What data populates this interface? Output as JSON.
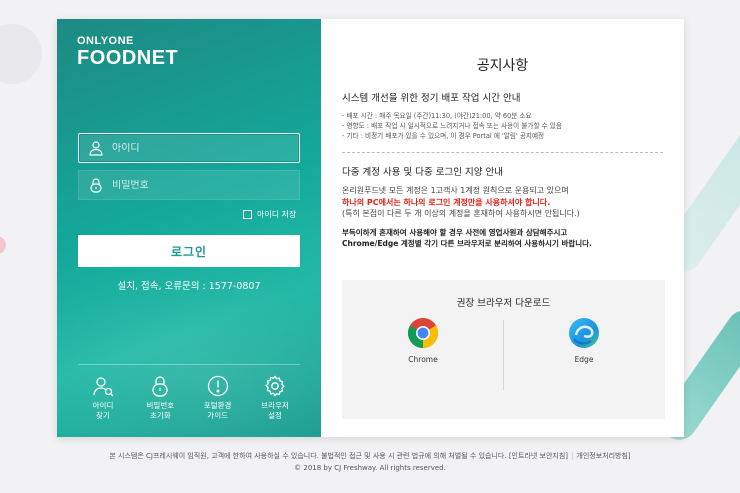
{
  "brand": {
    "line1": "ONLYONE",
    "line2": "FOODNET"
  },
  "login": {
    "id_placeholder": "아이디",
    "pw_placeholder": "비밀번호",
    "save_id_label": "아이디 저장",
    "login_button": "로그인",
    "contact": "설치, 접속, 오류문의 : 1577-0807"
  },
  "quick_links": [
    {
      "icon": "person-icon",
      "line1": "아이디",
      "line2": "찾기"
    },
    {
      "icon": "lock-icon",
      "line1": "비밀번호",
      "line2": "초기화"
    },
    {
      "icon": "alert-icon",
      "line1": "포털환경",
      "line2": "가이드"
    },
    {
      "icon": "gear-icon",
      "line1": "브라우저",
      "line2": "설정"
    }
  ],
  "notice": {
    "title": "공지사항",
    "section1": {
      "title": "시스템 개선을 위한 정기 배포 작업 시간 안내",
      "lines": [
        "- 배포 시간 : 매주 목요일 (주간)11:30, (야간)21:00, 약 60분 소요",
        "- 영향도 : 배포 작업 시 일시적으로 느려지거나 접속 또는 사용이 불가할 수 있음",
        "- 기타 : 비정기 배포가 있을 수 있으며, 이 경우 Portal 에 '알림' 공지예정"
      ]
    },
    "section2": {
      "title": "다중 계정 사용 및 다중 로그인 지양 안내",
      "line1": "온리원푸드넷 모든 계정은 1고객사 1계정 원칙으로 운용되고 있으며",
      "line_red": "하나의 PC에서는 하나의 로그인 계정만을 사용하셔야 합니다.",
      "line3": "(특히 본점이 다른 두 개 이상의 계정을 혼재하여 사용하시면 안됩니다.)",
      "bold1": "부득이하게 혼재하여 사용해야 할 경우 사전에 영업사원과 상담해주시고",
      "bold2": "Chrome/Edge 계정별 각기 다른 브라우저로 분리하여 사용하시기 바랍니다."
    }
  },
  "browsers": {
    "title": "권장 브라우저 다운로드",
    "chrome": "Chrome",
    "edge": "Edge"
  },
  "footer": {
    "line1": "본 시스템은 CJ프레시웨이 임직원, 고객에 한하여 사용하실 수 있습니다. 불법적인 접근 및 사용 시 관련 법규에 의해 처벌될 수 있습니다.",
    "link1": "[인트라넷 보안지침]",
    "link2": "개인정보처리방침]",
    "copyright": "© 2018 by CJ Freshway. All rights reserved."
  }
}
